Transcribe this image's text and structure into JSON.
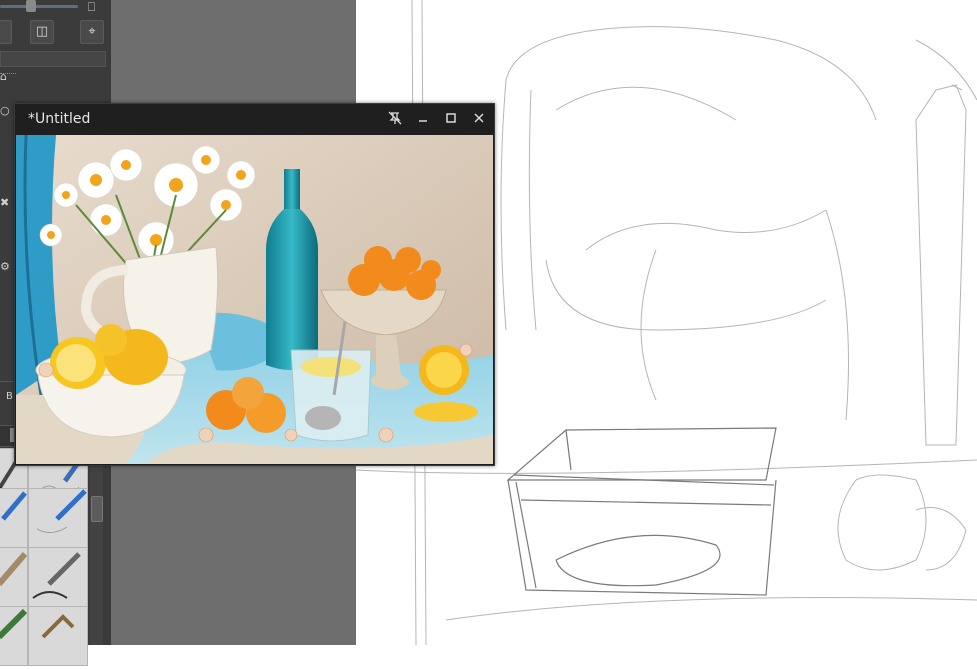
{
  "reference_window": {
    "title": "*Untitled",
    "controls": {
      "unpin": "unpin-icon",
      "minimize": "minimize-icon",
      "maximize": "maximize-icon",
      "close": "close-icon"
    },
    "image_description_icon": "still-life-photo"
  },
  "left_panel": {
    "bottom_label": "B",
    "toolbar": {
      "mirror_icon": "mirror-icon",
      "pin_icon": "pin-icon",
      "monitor_icon": "monitor-icon"
    },
    "brush_presets": [
      "pencil-preset",
      "pencil-blue-preset",
      "graphite-preset",
      "ink-pen-preset",
      "marker-preset",
      "smudge-preset"
    ]
  },
  "colors": {
    "panel_bg": "#3b3b3b",
    "workspace_bg": "#6e6e6e",
    "canvas_bg": "#ffffff",
    "window_titlebar": "#1f1f1f"
  }
}
